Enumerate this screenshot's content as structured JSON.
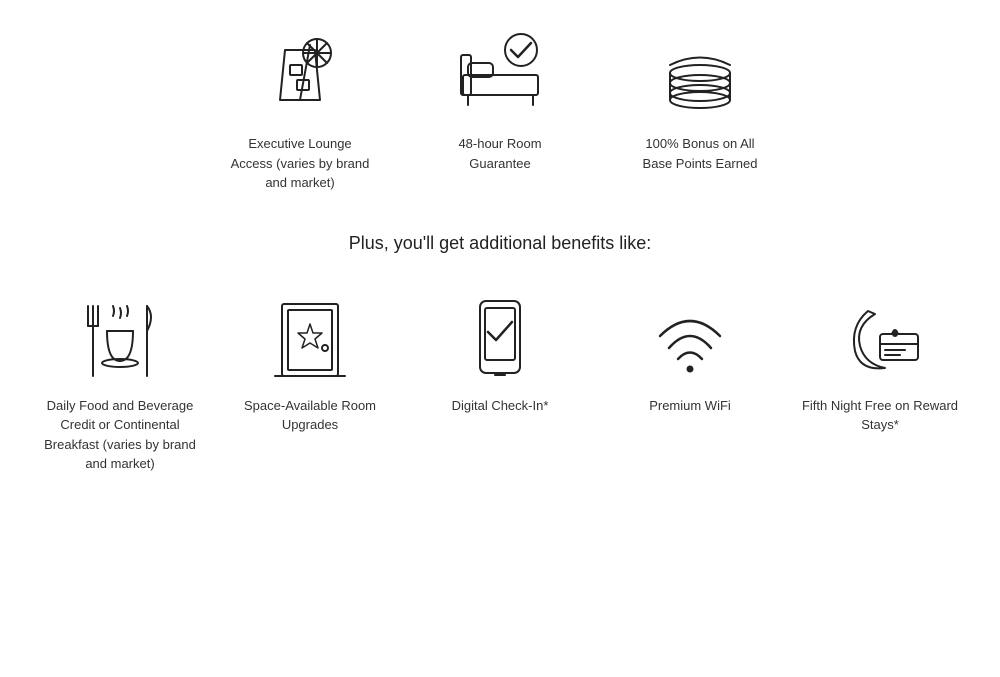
{
  "top_benefits": [
    {
      "id": "lounge-access",
      "label": "Executive Lounge Access (varies by brand and market)"
    },
    {
      "id": "room-guarantee",
      "label": "48-hour Room Guarantee"
    },
    {
      "id": "bonus-points",
      "label": "100% Bonus on All Base Points Earned"
    }
  ],
  "plus_heading": "Plus, you'll get additional benefits like:",
  "bottom_benefits": [
    {
      "id": "food-beverage",
      "label": "Daily Food and Beverage Credit or Continental Breakfast (varies by brand and market)"
    },
    {
      "id": "room-upgrades",
      "label": "Space-Available Room Upgrades"
    },
    {
      "id": "digital-checkin",
      "label": "Digital Check-In*"
    },
    {
      "id": "wifi",
      "label": "Premium WiFi"
    },
    {
      "id": "fifth-night",
      "label": "Fifth Night Free on Reward Stays*"
    }
  ]
}
